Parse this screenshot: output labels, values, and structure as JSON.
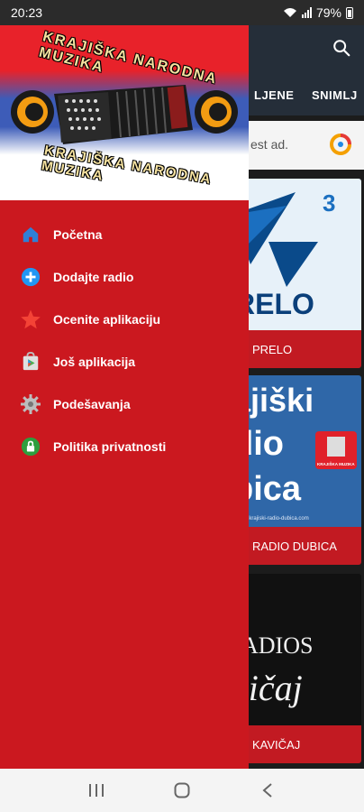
{
  "status_bar": {
    "time": "20:23",
    "battery": "79%"
  },
  "background_app": {
    "tabs": [
      "LJENE",
      "SNIMLJ"
    ],
    "ad_text": "est ad.",
    "stations": [
      {
        "name": "PRELO",
        "logo_text": "RELO",
        "logo_badge": "3"
      },
      {
        "name": "RADIO DUBICA",
        "logo_lines": [
          "ajiški",
          "dio",
          "bica"
        ],
        "badge_text": "KRAJIŠKA MUZIKA",
        "url": "www.krajiski-radio-dubica.com"
      },
      {
        "name": "KAVIČAJ",
        "logo_lines": [
          "ADIOS",
          "vičaj"
        ]
      }
    ]
  },
  "drawer": {
    "header": {
      "logo_top": "KRAJIŠKA NARODNA MUZIKA",
      "logo_bottom": "KRAJIŠKA NARODNA MUZIKA"
    },
    "menu": [
      {
        "label": "Početna",
        "icon": "home-icon",
        "color": "#2f7fd6"
      },
      {
        "label": "Dodajte radio",
        "icon": "add-circle-icon",
        "color": "#2196f3"
      },
      {
        "label": "Ocenite aplikaciju",
        "icon": "star-icon",
        "color": "#f44336"
      },
      {
        "label": "Još aplikacija",
        "icon": "play-store-icon",
        "color": "#4caf50"
      },
      {
        "label": "Podešavanja",
        "icon": "gear-icon",
        "color": "#9e9e9e"
      },
      {
        "label": "Politika privatnosti",
        "icon": "lock-icon",
        "color": "#2e9e3e"
      }
    ]
  },
  "colors": {
    "drawer_bg": "#cb181f",
    "appbar_bg": "#252e39",
    "station_label_bg": "#c21a22"
  }
}
